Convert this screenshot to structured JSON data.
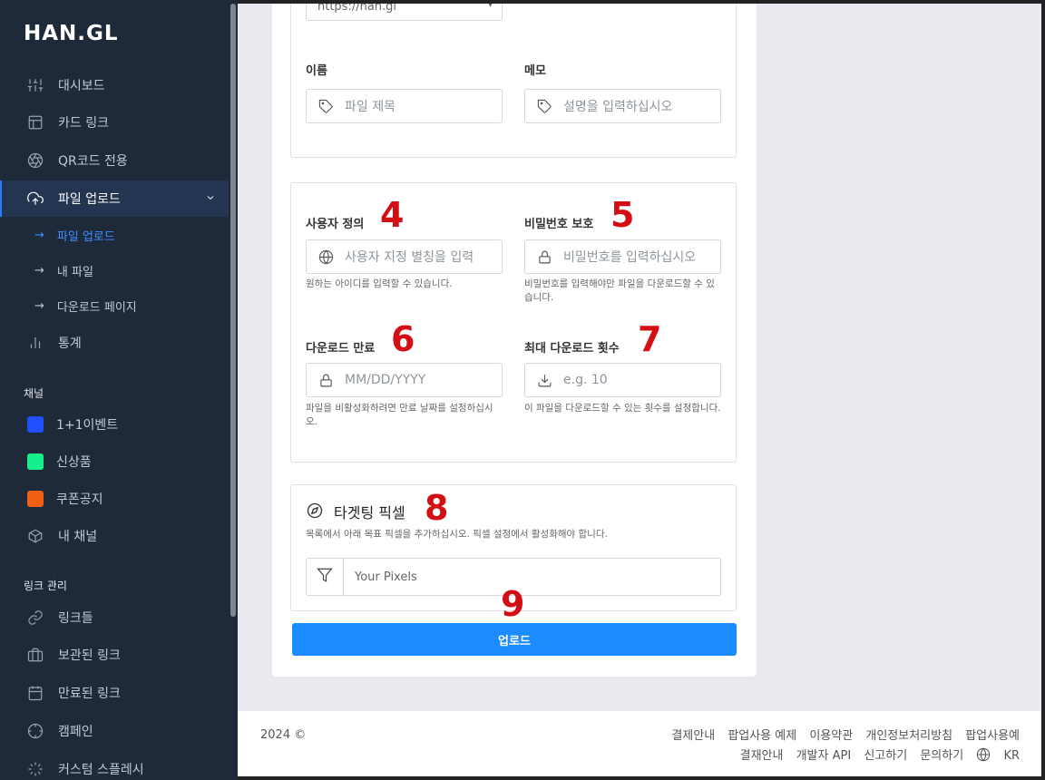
{
  "brand": {
    "logo": "HAN.GL"
  },
  "sidebar": {
    "items": [
      {
        "label": "대시보드",
        "icon": "sliders-icon"
      },
      {
        "label": "카드 링크",
        "icon": "layout-icon"
      },
      {
        "label": "QR코드 전용",
        "icon": "aperture-icon"
      },
      {
        "label": "파일 업로드",
        "icon": "upload-cloud-icon",
        "active": true
      }
    ],
    "subitems": [
      {
        "label": "파일 업로드",
        "active": true
      },
      {
        "label": "내 파일"
      },
      {
        "label": "다운로드 페이지"
      }
    ],
    "stats": {
      "label": "통계",
      "icon": "bar-chart-icon"
    },
    "channels_title": "채널",
    "channels": [
      {
        "label": "1+1이벤트",
        "color": "#1f4fff"
      },
      {
        "label": "신상품",
        "color": "#16f08a"
      },
      {
        "label": "쿠폰공지",
        "color": "#f06014"
      },
      {
        "label": "내 채널",
        "icon": "box-icon"
      }
    ],
    "links_title": "링크 관리",
    "link_items": [
      {
        "label": "링크들",
        "icon": "link-icon"
      },
      {
        "label": "보관된 링크",
        "icon": "briefcase-icon"
      },
      {
        "label": "만료된 링크",
        "icon": "calendar-icon"
      },
      {
        "label": "캠페인",
        "icon": "crosshair-icon"
      },
      {
        "label": "커스텀 스플레시",
        "icon": "loader-icon"
      }
    ]
  },
  "form": {
    "domain_value": "https://han.gl",
    "name": {
      "label": "이름",
      "placeholder": "파일 제목"
    },
    "memo": {
      "label": "메모",
      "placeholder": "설명을 입력하십시오"
    },
    "alias": {
      "label": "사용자 정의",
      "placeholder": "사용자 지정 별칭을 입력",
      "hint": "원하는 아이디를 입력할 수 있습니다."
    },
    "password": {
      "label": "비밀번호 보호",
      "placeholder": "비밀번호를 입력하십시오",
      "hint": "비밀번호를 입력해야만 파일을 다운로드할 수 있습니다."
    },
    "expiry": {
      "label": "다운로드 만료",
      "placeholder": "MM/DD/YYYY",
      "hint": "파일을 비활성화하려면 만료 날짜를 설정하십시오."
    },
    "max_downloads": {
      "label": "최대 다운로드 횟수",
      "placeholder": "e.g. 10",
      "hint": "이 파일을 다운로드할 수 있는 횟수를 설정합니다."
    },
    "pixels": {
      "title": "타겟팅 픽셀",
      "desc": "목록에서 아래 목표 픽셀을 추가하십시오. 픽셀 설정에서 활성화해야 합니다.",
      "placeholder": "Your Pixels"
    },
    "submit": "업로드"
  },
  "annotations": [
    "4",
    "5",
    "6",
    "7",
    "8",
    "9"
  ],
  "footer": {
    "copyright": "2024 ©",
    "links": [
      "결제안내",
      "팝업사용 예제",
      "이용약관",
      "개인정보처리방침",
      "팝업사용예",
      "결재안내",
      "개발자 API",
      "신고하기",
      "문의하기"
    ],
    "lang": "KR"
  }
}
